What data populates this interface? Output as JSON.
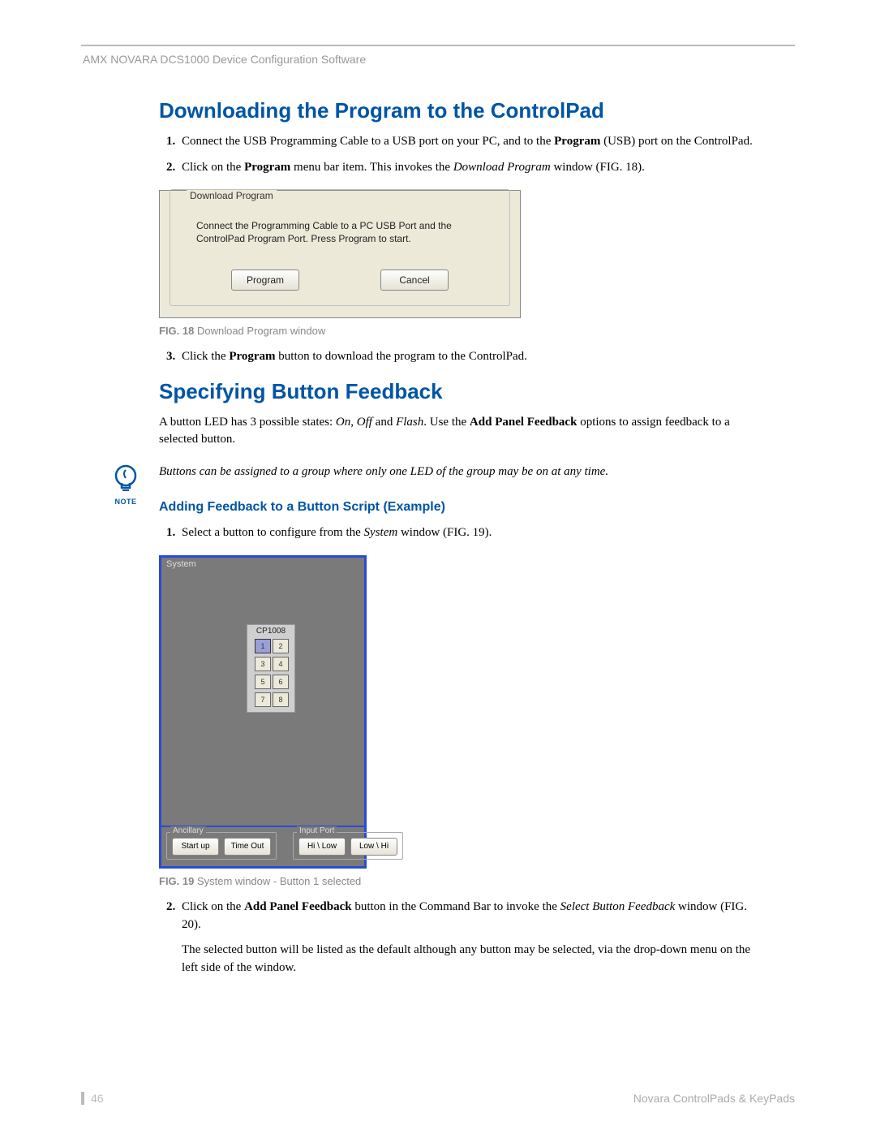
{
  "header": "AMX NOVARA DCS1000 Device Configuration Software",
  "section1": {
    "title": "Downloading the Program to the ControlPad",
    "step1_a": "Connect the USB Programming Cable to a USB port on your PC, and to the ",
    "step1_b": "Program",
    "step1_c": " (USB) port on the ControlPad.",
    "step2_a": "Click on the ",
    "step2_b": "Program",
    "step2_c": " menu bar item. This invokes the ",
    "step2_d": "Download Program",
    "step2_e": " window (FIG. 18).",
    "step3_a": "Click the ",
    "step3_b": "Program",
    "step3_c": " button to download the program to the ControlPad."
  },
  "dlg": {
    "title": "Download Program",
    "text": "Connect  the Programming Cable to a PC USB Port and the ControlPad Program Port.  Press Program to start.",
    "btn_program": "Program",
    "btn_cancel": "Cancel"
  },
  "fig18": {
    "label": "FIG. 18",
    "caption": "  Download Program window"
  },
  "section2": {
    "title": "Specifying Button Feedback",
    "intro_a": "A button LED has 3 possible states: ",
    "intro_on": "On",
    "intro_sep1": ", ",
    "intro_off": "Off",
    "intro_sep2": " and ",
    "intro_flash": "Flash",
    "intro_b": ". Use the ",
    "intro_c": "Add Panel Feedback",
    "intro_d": " options to assign feedback to a selected button."
  },
  "note": {
    "label": "NOTE",
    "text": "Buttons can be assigned to a group where only one LED of the group may be on at any time."
  },
  "sub1": {
    "title": "Adding Feedback to a Button Script (Example)",
    "step1_a": "Select a button to configure from the ",
    "step1_b": "System",
    "step1_c": " window (FIG. 19).",
    "step2_a": "Click on the ",
    "step2_b": "Add Panel Feedback",
    "step2_c": " button in the Command Bar to invoke the ",
    "step2_d": "Select Button Feedback",
    "step2_e": " window (FIG. 20).",
    "step2_para2": "The selected button will be listed as the default although any button may be selected, via the drop-down menu on the left side of the window."
  },
  "syswin": {
    "label": "System",
    "cp_title": "CP1008",
    "buttons": [
      "1",
      "2",
      "3",
      "4",
      "5",
      "6",
      "7",
      "8"
    ],
    "grp_ancillary": "Ancillary",
    "btn_startup": "Start up",
    "btn_timeout": "Time Out",
    "grp_input": "Input Port",
    "btn_hilow": "Hi \\ Low",
    "btn_lowhi": "Low \\ Hi"
  },
  "fig19": {
    "label": "FIG. 19",
    "caption": "  System window - Button 1 selected"
  },
  "footer": {
    "page": "46",
    "doc": "Novara ControlPads  & KeyPads"
  }
}
